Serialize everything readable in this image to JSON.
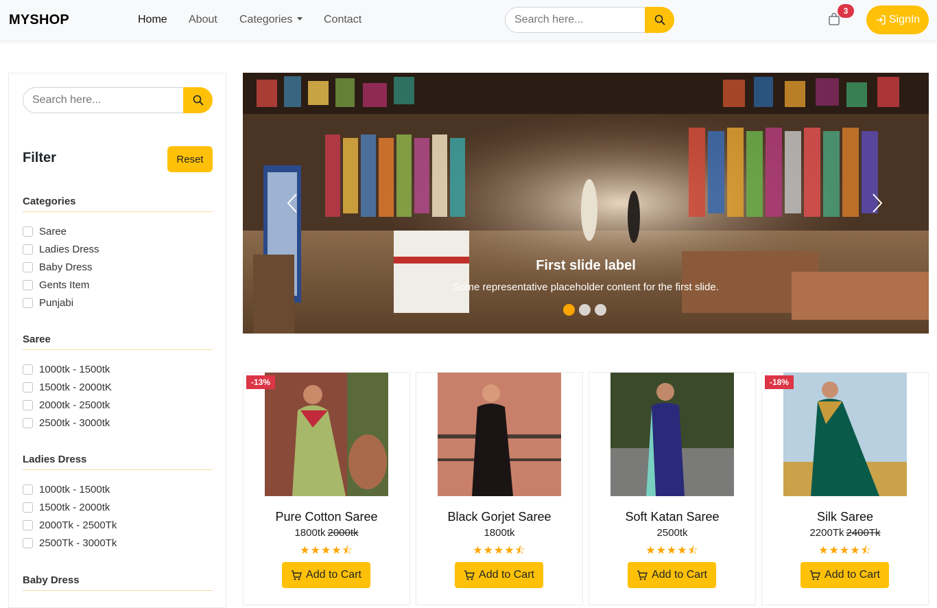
{
  "nav": {
    "brand": "MYSHOP",
    "links": [
      "Home",
      "About",
      "Categories",
      "Contact"
    ],
    "search_placeholder": "Search here...",
    "cart_count": "3",
    "signin_label": "SignIn"
  },
  "sidebar": {
    "search_placeholder": "Search here...",
    "filter_title": "Filter",
    "reset_label": "Reset",
    "groups": [
      {
        "title": "Categories",
        "options": [
          "Saree",
          "Ladies Dress",
          "Baby Dress",
          "Gents Item",
          "Punjabi"
        ]
      },
      {
        "title": "Saree",
        "options": [
          "1000tk - 1500tk",
          "1500tk - 2000tK",
          "2000tk - 2500tk",
          "2500tk - 3000tk"
        ]
      },
      {
        "title": "Ladies Dress",
        "options": [
          "1000tk - 1500tk",
          "1500tk - 2000tk",
          "2000Tk - 2500Tk",
          "2500Tk - 3000Tk"
        ]
      },
      {
        "title": "Baby Dress",
        "options": []
      }
    ]
  },
  "carousel": {
    "title": "First slide label",
    "text": "Some representative placeholder content for the first slide.",
    "slide_count": 3,
    "active_slide": 1
  },
  "products": [
    {
      "name": "Pure Cotton Saree",
      "price": "1800tk",
      "old_price": "2000tk",
      "discount": "-13%",
      "rating": 4.5,
      "cart_label": "Add to Cart"
    },
    {
      "name": "Black Gorjet Saree",
      "price": "1800tk",
      "old_price": "",
      "discount": "",
      "rating": 4.5,
      "cart_label": "Add to Cart"
    },
    {
      "name": "Soft Katan Saree",
      "price": "2500tk",
      "old_price": "",
      "discount": "",
      "rating": 4.5,
      "cart_label": "Add to Cart"
    },
    {
      "name": "Silk Saree",
      "price": "2200Tk",
      "old_price": "2400Tk",
      "discount": "-18%",
      "rating": 4.5,
      "cart_label": "Add to Cart"
    }
  ],
  "colors": {
    "accent": "#ffc107",
    "badge": "#dc3545",
    "star": "#ffa500"
  }
}
